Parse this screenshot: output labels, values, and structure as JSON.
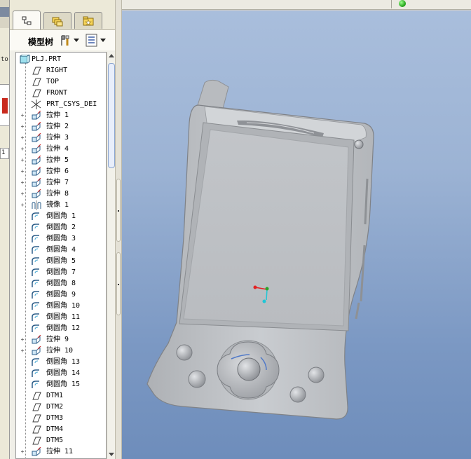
{
  "left_strip": {
    "fragment_top": "to",
    "fragment_mid": "1"
  },
  "tabs": [
    {
      "name": "model-tree",
      "icon": "model-tree-icon",
      "active": true
    },
    {
      "name": "folder-browser",
      "icon": "folder-icon",
      "active": false
    },
    {
      "name": "favorites",
      "icon": "favorites-icon",
      "active": false
    }
  ],
  "toolbar": {
    "title": "模型树"
  },
  "tree": {
    "items": [
      {
        "label": "PLJ.PRT",
        "type": "part",
        "expandable": false
      },
      {
        "label": "RIGHT",
        "type": "datum-plane",
        "expandable": false
      },
      {
        "label": "TOP",
        "type": "datum-plane",
        "expandable": false
      },
      {
        "label": "FRONT",
        "type": "datum-plane",
        "expandable": false
      },
      {
        "label": "PRT_CSYS_DEI",
        "type": "csys",
        "expandable": false
      },
      {
        "label": "拉伸 1",
        "type": "extrude",
        "expandable": true
      },
      {
        "label": "拉伸 2",
        "type": "extrude",
        "expandable": true
      },
      {
        "label": "拉伸 3",
        "type": "extrude",
        "expandable": true
      },
      {
        "label": "拉伸 4",
        "type": "extrude",
        "expandable": true
      },
      {
        "label": "拉伸 5",
        "type": "extrude",
        "expandable": true
      },
      {
        "label": "拉伸 6",
        "type": "extrude",
        "expandable": true
      },
      {
        "label": "拉伸 7",
        "type": "extrude",
        "expandable": true
      },
      {
        "label": "拉伸 8",
        "type": "extrude",
        "expandable": true
      },
      {
        "label": "镜像 1",
        "type": "mirror",
        "expandable": true
      },
      {
        "label": "倒圆角 1",
        "type": "round",
        "expandable": false
      },
      {
        "label": "倒圆角 2",
        "type": "round",
        "expandable": false
      },
      {
        "label": "倒圆角 3",
        "type": "round",
        "expandable": false
      },
      {
        "label": "倒圆角 4",
        "type": "round",
        "expandable": false
      },
      {
        "label": "倒圆角 5",
        "type": "round",
        "expandable": false
      },
      {
        "label": "倒圆角 7",
        "type": "round",
        "expandable": false
      },
      {
        "label": "倒圆角 8",
        "type": "round",
        "expandable": false
      },
      {
        "label": "倒圆角 9",
        "type": "round",
        "expandable": false
      },
      {
        "label": "倒圆角 10",
        "type": "round",
        "expandable": false
      },
      {
        "label": "倒圆角 11",
        "type": "round",
        "expandable": false
      },
      {
        "label": "倒圆角 12",
        "type": "round",
        "expandable": false
      },
      {
        "label": "拉伸 9",
        "type": "extrude",
        "expandable": true
      },
      {
        "label": "拉伸 10",
        "type": "extrude",
        "expandable": true
      },
      {
        "label": "倒圆角 13",
        "type": "round",
        "expandable": false
      },
      {
        "label": "倒圆角 14",
        "type": "round",
        "expandable": false
      },
      {
        "label": "倒圆角 15",
        "type": "round",
        "expandable": false
      },
      {
        "label": "DTM1",
        "type": "datum-plane",
        "expandable": false
      },
      {
        "label": "DTM2",
        "type": "datum-plane",
        "expandable": false
      },
      {
        "label": "DTM3",
        "type": "datum-plane",
        "expandable": false
      },
      {
        "label": "DTM4",
        "type": "datum-plane",
        "expandable": false
      },
      {
        "label": "DTM5",
        "type": "datum-plane",
        "expandable": false
      },
      {
        "label": "拉伸 11",
        "type": "extrude",
        "expandable": true
      }
    ]
  },
  "colors": {
    "viewport_top": "#a9bedc",
    "viewport_bottom": "#6e8dbb",
    "model_body": "#c3c6ca",
    "axis_x": "#e32222",
    "axis_y": "#2aa52a",
    "axis_z": "#1fc6d6",
    "status_light": "#1b9c12"
  }
}
